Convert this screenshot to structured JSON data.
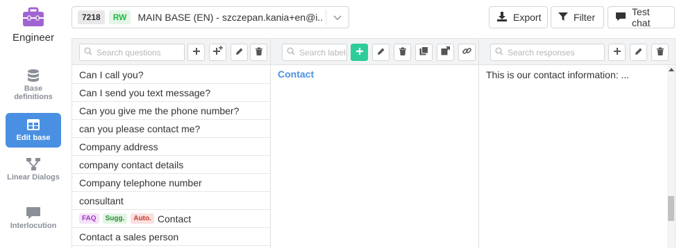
{
  "app": {
    "name": "Engineer"
  },
  "nav": {
    "items": [
      {
        "label": "Base definitions",
        "icon": "database-icon",
        "active": false
      },
      {
        "label": "Edit base",
        "icon": "table-icon",
        "active": true
      },
      {
        "label": "Linear Dialogs",
        "icon": "sitemap-icon",
        "active": false
      },
      {
        "label": "Interlocution",
        "icon": "comment-icon",
        "active": false
      }
    ]
  },
  "base_selector": {
    "id": "7218",
    "mode": "RW",
    "name": "MAIN BASE (EN) - szczepan.kania+en@i..."
  },
  "toolbar": {
    "export_label": "Export",
    "filter_label": "Filter",
    "test_chat_label": "Test chat"
  },
  "questions": {
    "search_placeholder": "Search questions",
    "items": [
      {
        "text": "Can I call you?"
      },
      {
        "text": "Can I send you text message?"
      },
      {
        "text": "Can you give me the phone number?"
      },
      {
        "text": "can you please contact me?"
      },
      {
        "text": "Company address"
      },
      {
        "text": "company contact details"
      },
      {
        "text": "Company telephone number"
      },
      {
        "text": "consultant"
      },
      {
        "text": "Contact",
        "tags": [
          "FAQ",
          "Sugg.",
          "Auto."
        ]
      },
      {
        "text": "Contact a sales person"
      }
    ]
  },
  "labels": {
    "search_placeholder": "Search labels",
    "selected": "Contact"
  },
  "responses": {
    "search_placeholder": "Search responses",
    "items": [
      {
        "text": "This is our contact information: ..."
      }
    ]
  },
  "colors": {
    "accent": "#4a90e2",
    "brand": "#a064d2",
    "add_green": "#2ecc9a"
  }
}
